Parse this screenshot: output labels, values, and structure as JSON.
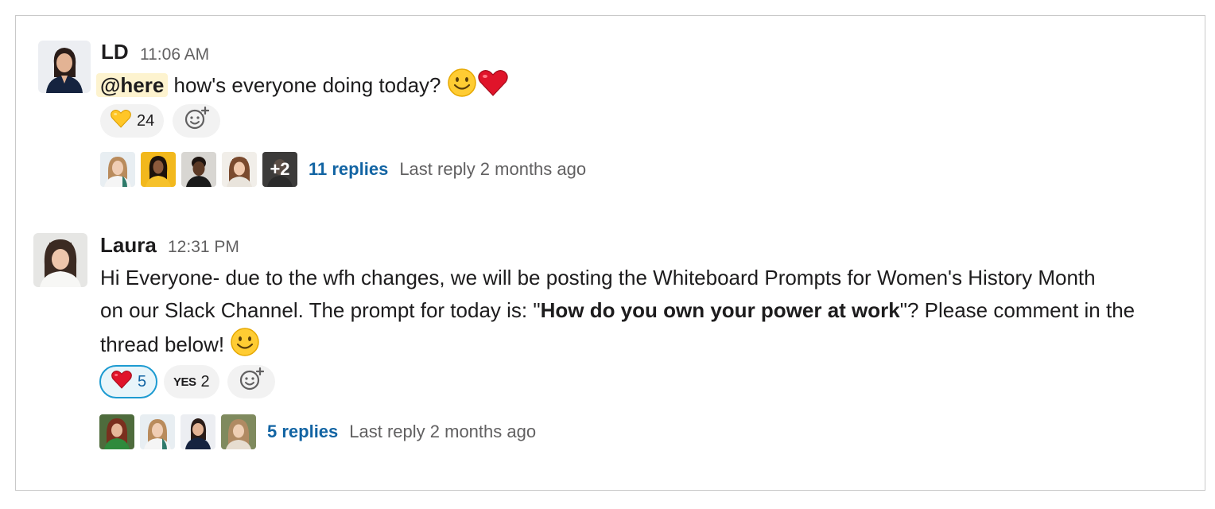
{
  "messages": [
    {
      "author": "LD",
      "time": "11:06 AM",
      "mention": "@here",
      "text": "how's everyone doing today?",
      "reactions": [
        {
          "emoji": "yellow-heart",
          "count": "24"
        }
      ],
      "thread": {
        "more_count": "+2",
        "replies": "11 replies",
        "last_reply": "Last reply 2 months ago"
      }
    },
    {
      "author": "Laura",
      "time": "12:31 PM",
      "text_line1": "Hi Everyone- due to the wfh changes, we will be posting the Whiteboard Prompts for Women's History Month",
      "text_line2_pre": "on our Slack Channel. The prompt for today is: \"",
      "text_line2_bold": "How do you own your power at work",
      "text_line2_post": "\"? Please comment in the",
      "text_line3": "thread below!",
      "reactions": [
        {
          "emoji": "red-heart",
          "count": "5",
          "active": true
        },
        {
          "emoji": "yes",
          "label": "YES",
          "count": "2"
        }
      ],
      "thread": {
        "replies": "5 replies",
        "last_reply": "Last reply 2 months ago"
      }
    }
  ],
  "colors": {
    "link": "#1264a3",
    "mention_bg": "#fdf3cf",
    "reaction_bg": "#f2f2f2",
    "active_border": "#1d9bd1",
    "muted": "#616061"
  }
}
